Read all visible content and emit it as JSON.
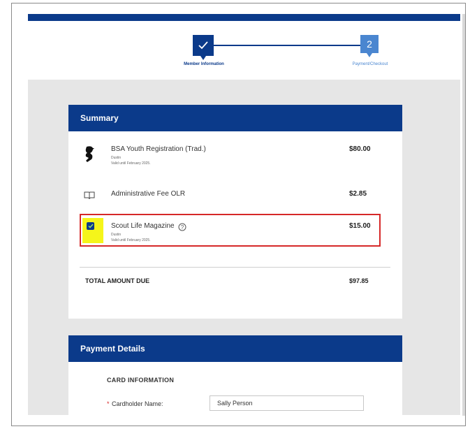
{
  "stepper": {
    "step1_label": "Member Information",
    "step2_number": "2",
    "step2_label": "Payment/Checkout"
  },
  "summary": {
    "title": "Summary",
    "items": [
      {
        "icon": "scout-silhouette-icon",
        "name": "BSA Youth Registration (Trad.)",
        "sub1": "Dustin",
        "sub2": "Valid until February 2025.",
        "price": "$80.00"
      },
      {
        "icon": "book-icon",
        "name": "Administrative Fee OLR",
        "price": "$2.85"
      },
      {
        "icon": "checkbox-icon",
        "name": "Scout Life Magazine",
        "help_icon": "help-circle-icon",
        "sub1": "Dustin",
        "sub2": "Valid until February 2025.",
        "price": "$15.00",
        "checked": true
      }
    ],
    "total_label": "TOTAL AMOUNT DUE",
    "total_amount": "$97.85"
  },
  "payment": {
    "title": "Payment Details",
    "section_title": "CARD INFORMATION",
    "cardholder_label": "Cardholder Name:",
    "cardholder_value": "Sally Person",
    "required_mark": "*"
  },
  "colors": {
    "brand_navy": "#0b3a8a",
    "step_blue": "#4a86d0",
    "highlight_red": "#d62828",
    "highlight_yellow": "#f5f51a"
  }
}
